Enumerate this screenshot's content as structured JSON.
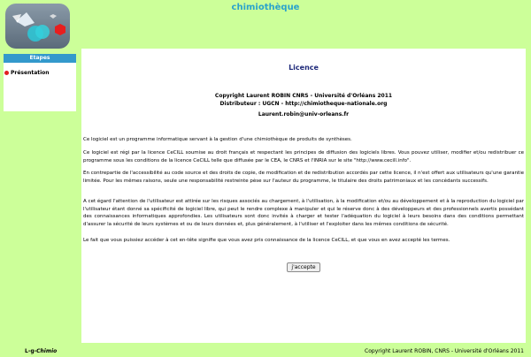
{
  "header": {
    "app_title": "chimiothèque"
  },
  "sidebar": {
    "header_label": "Etapes",
    "items": [
      {
        "label": "Présentation",
        "active": true
      }
    ]
  },
  "main": {
    "title": "Licence",
    "copyright_line1": "Copyright Laurent ROBIN CNRS - Université d'Orléans 2011",
    "copyright_line2": "Distributeur : UGCN - http://chimiotheque-nationale.org",
    "email": "Laurent.robin@univ-orleans.fr",
    "paragraphs": [
      "Ce logiciel est un programme informatique servant à la gestion d'une chimiothèque de produits de synthèses.",
      "Ce logiciel est régi par la licence CeCILL soumise au droit français et respectant les principes de diffusion des logiciels libres. Vous pouvez utiliser, modifier et/ou redistribuer ce programme sous les conditions de la licence CeCILL telle que diffusée par le CEA, le CNRS et l'INRIA sur le site \"http://www.cecill.info\".",
      "En contrepartie de l'accessibilité au code source et des droits de copie, de modification et de redistribution accordés par cette licence, il n'est offert aux utilisateurs qu'une garantie limitée. Pour les mêmes raisons, seule une responsabilité restreinte pèse sur l'auteur du programme, le titulaire des droits patrimoniaux et les concédants successifs.",
      "A cet égard l'attention de l'utilisateur est attirée sur les risques associés au chargement, à l'utilisation, à la modification et/ou au développement et à la reproduction du logiciel par l'utilisateur étant donné sa spécificité de logiciel libre, qui peut le rendre complexe à manipuler et qui le réserve donc à des développeurs et des professionnels avertis possédant des connaissances informatiques approfondies. Les utilisateurs sont donc invités à charger et tester l'adéquation du logiciel à leurs besoins dans des conditions permettant d'assurer la sécurité de leurs systèmes et ou de leurs données et, plus généralement, à l'utiliser et l'exploiter dans les mêmes conditions de sécurité.",
      "Le fait que vous puissiez accéder à cet en-tête signifie que vous avez pris connaissance de la licence CeCILL, et que vous en avez accepté les termes."
    ],
    "accept_label": "j'accepte"
  },
  "footer": {
    "left_prefix": "L-g-",
    "left_italic": "Chimio",
    "right_text": "Copyright Laurent ROBIN, CNRS - Université d'Orléans 2011"
  },
  "colors": {
    "page_background": "#ccff99",
    "title_accent": "#2aa3cc",
    "sidebar_header": "#3399cc",
    "licence_title": "#1f2a7a",
    "bullet": "#e02020"
  },
  "icons": {
    "logo": "chimiotheque-logo"
  }
}
